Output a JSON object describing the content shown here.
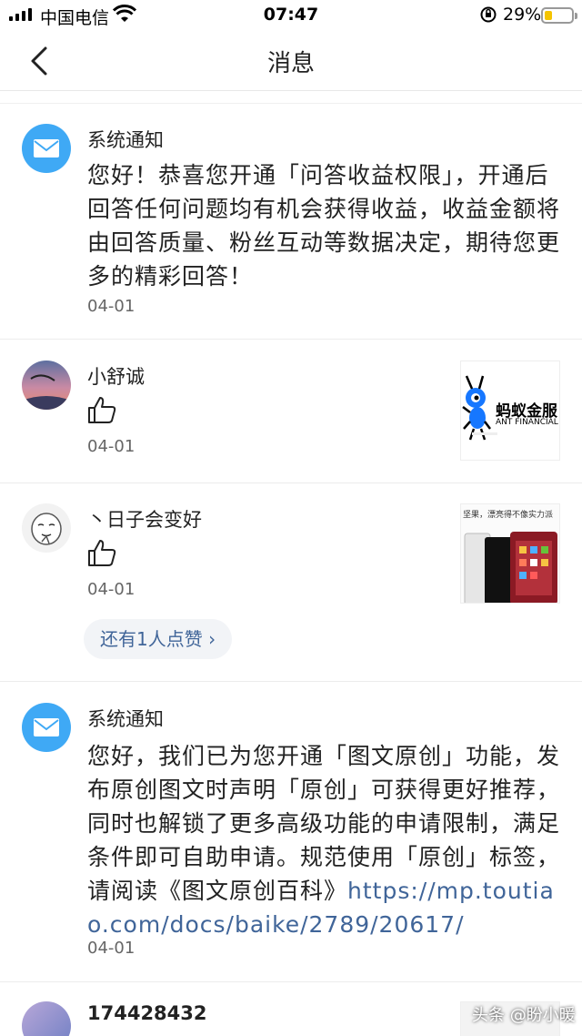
{
  "status_bar": {
    "carrier": "中国电信",
    "time": "07:47",
    "battery_percent_text": "29%",
    "battery_level": 0.29,
    "battery_color": "#f5c400"
  },
  "nav": {
    "back_icon": "chevron-left-icon",
    "title": "消息"
  },
  "messages": [
    {
      "sender": "系统通知",
      "text": "您好！恭喜您开通「问答收益权限」，开通后回答任何问题均有机会获得收益，收益金额将由回答质量、粉丝互动等数据决定，期待您更多的精彩回答！",
      "date": "04-01"
    },
    {
      "sender": "小舒诚",
      "reaction_icon": "thumbs-up-icon",
      "date": "04-01",
      "thumbnail": {
        "line1": "蚂蚁金服",
        "line2": "ANT FINANCIAL"
      }
    },
    {
      "sender": "丶日子会变好",
      "reaction_icon": "thumbs-up-icon",
      "date": "04-01",
      "thumbnail": {
        "caption": "坚果，漂亮得不像实力派"
      }
    },
    {
      "more_likes": "还有1人点赞 ›"
    },
    {
      "sender": "系统通知",
      "text": "您好，我们已为您开通「图文原创」功能，发布原创图文时声明「原创」可获得更好推荐，同时也解锁了更多高级功能的申请限制，满足条件即可自助申请。规范使用「原创」标签，请阅读《图文原创百科》",
      "link": "https://mp.toutiao.com/docs/baike/2789/20617/",
      "date": "04-01"
    },
    {
      "sender": "174428432"
    }
  ],
  "watermark": "头条 @盼小暖",
  "colors": {
    "accent_blue": "#3fa9f5",
    "link": "#406599"
  }
}
